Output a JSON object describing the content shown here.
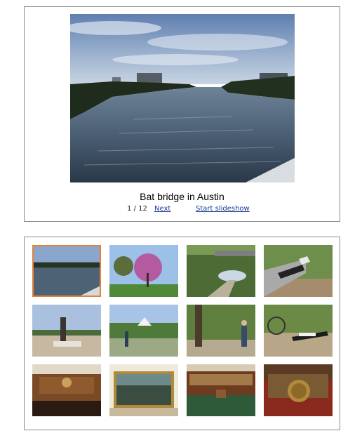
{
  "viewer": {
    "caption": "Bat bridge in Austin",
    "counter": "1 / 12",
    "next_label": "Next",
    "slideshow_label": "Start slideshow"
  },
  "thumbnails": [
    {
      "subject": "river-at-dusk",
      "selected": true
    },
    {
      "subject": "flowering-redbud-tree",
      "selected": false
    },
    {
      "subject": "bridge-over-trail",
      "selected": false
    },
    {
      "subject": "sculpture-by-trees",
      "selected": false
    },
    {
      "subject": "statue-on-plaza",
      "selected": false
    },
    {
      "subject": "park-with-gazebo",
      "selected": false
    },
    {
      "subject": "man-with-bicycle",
      "selected": false
    },
    {
      "subject": "bicycle-and-bench",
      "selected": false
    },
    {
      "subject": "courtroom-chamber",
      "selected": false
    },
    {
      "subject": "framed-painting",
      "selected": false
    },
    {
      "subject": "legislative-chamber",
      "selected": false
    },
    {
      "subject": "state-seal-desk",
      "selected": false
    }
  ]
}
